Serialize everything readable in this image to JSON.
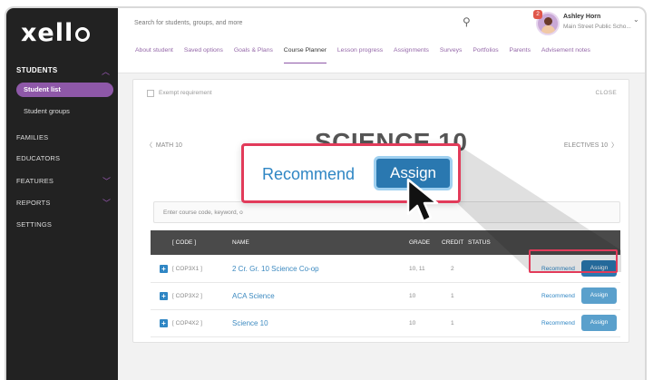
{
  "sidebar": {
    "logo": "xell",
    "section_students": "STUDENTS",
    "items": [
      {
        "label": "Student list",
        "active": true
      },
      {
        "label": "Student groups",
        "active": false
      }
    ],
    "families": "FAMILIES",
    "educators": "EDUCATORS",
    "features": "FEATURES",
    "reports": "REPORTS",
    "settings": "SETTINGS"
  },
  "header": {
    "search_placeholder": "Search for students, groups, and more",
    "notification_count": "2",
    "user_name": "Ashley Horn",
    "user_school": "Main Street Public Scho..."
  },
  "tabs": [
    {
      "label": "About student",
      "active": false
    },
    {
      "label": "Saved options",
      "active": false
    },
    {
      "label": "Goals & Plans",
      "active": false
    },
    {
      "label": "Course Planner",
      "active": true
    },
    {
      "label": "Lesson progress",
      "active": false
    },
    {
      "label": "Assignments",
      "active": false
    },
    {
      "label": "Surveys",
      "active": false
    },
    {
      "label": "Portfolios",
      "active": false
    },
    {
      "label": "Parents",
      "active": false
    },
    {
      "label": "Advisement notes",
      "active": false
    }
  ],
  "panel": {
    "exempt_label": "Exempt requirement",
    "close_label": "CLOSE",
    "course_title": "SCIENCE 10",
    "prev_course": "MATH 10",
    "next_course": "ELECTIVES 10",
    "filter_placeholder": "Enter course code, keyword, o"
  },
  "table": {
    "headers": {
      "code": "[ CODE ]",
      "name": "NAME",
      "grade": "GRADE",
      "credit": "CREDIT",
      "status": "STATUS"
    },
    "rows": [
      {
        "code": "[ COP3X1 ]",
        "name": "2 Cr. Gr. 10 Science Co-op",
        "grade": "10, 11",
        "credit": "2",
        "recommend": "Recommend",
        "assign": "Assign"
      },
      {
        "code": "[ COP3X2 ]",
        "name": "ACA Science",
        "grade": "10",
        "credit": "1",
        "recommend": "Recommend",
        "assign": "Assign"
      },
      {
        "code": "[ COP4X2 ]",
        "name": "Science 10",
        "grade": "10",
        "credit": "1",
        "recommend": "Recommend",
        "assign": "Assign"
      }
    ]
  },
  "zoom": {
    "recommend": "Recommend",
    "assign": "Assign"
  },
  "colors": {
    "brand_purple": "#8e58a8",
    "link_blue": "#2f86c4",
    "highlight_red": "#e23b5a"
  }
}
